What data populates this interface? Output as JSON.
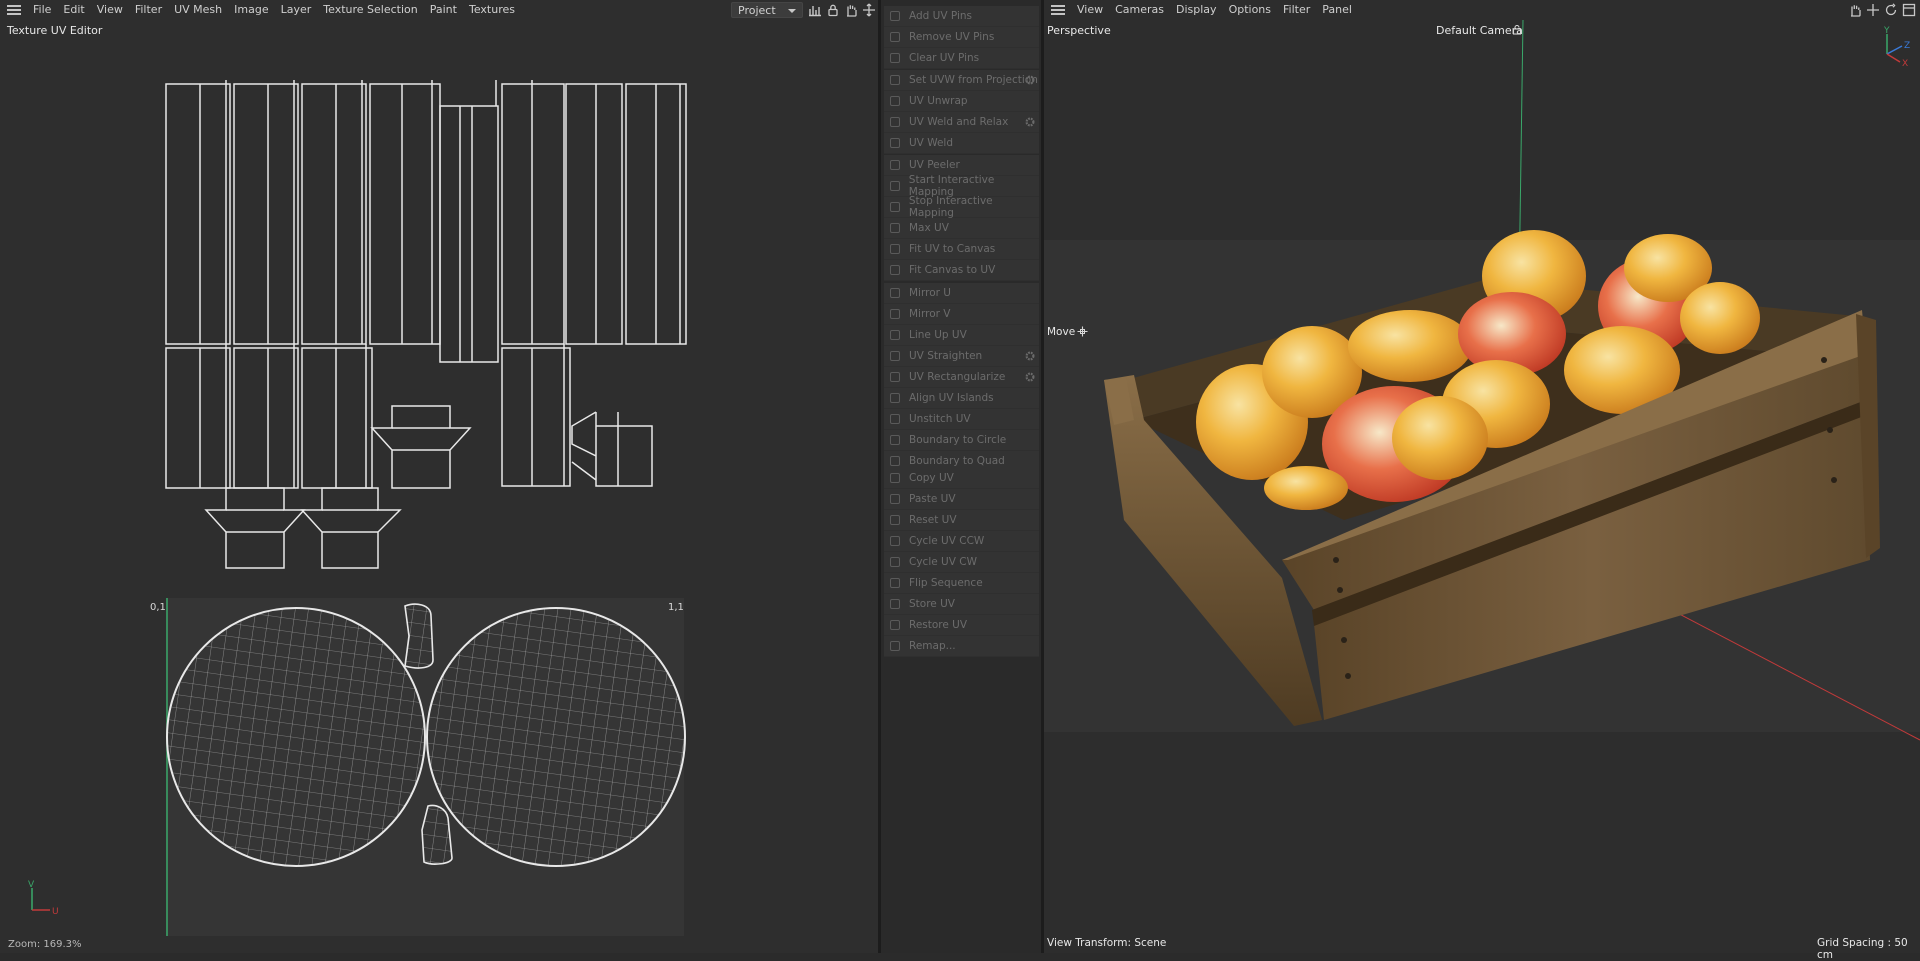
{
  "uv_editor": {
    "menu": [
      "File",
      "Edit",
      "View",
      "Filter",
      "UV Mesh",
      "Image",
      "Layer",
      "Texture Selection",
      "Paint",
      "Textures"
    ],
    "project_select": "Project",
    "title": "Texture UV Editor",
    "corner_tl": "0,1",
    "corner_tr": "1,1",
    "axis_v": "V",
    "axis_u": "U",
    "zoom": "Zoom: 169.3%"
  },
  "uv_commands": {
    "groups": [
      [
        "Add UV Pins",
        "Remove UV Pins",
        "Clear UV Pins"
      ],
      [
        "Set UVW from Projection",
        "UV Unwrap",
        "UV Weld and Relax",
        "UV Weld"
      ],
      [
        "UV Peeler",
        "Start Interactive Mapping",
        "Stop Interactive Mapping"
      ],
      [
        "Max UV",
        "Fit UV to Canvas",
        "Fit Canvas to UV"
      ],
      [
        "Mirror U",
        "Mirror V",
        "Line Up UV",
        "UV Straighten",
        "UV Rectangularize",
        "Align UV Islands",
        "Unstitch UV",
        "Boundary to Circle",
        "Boundary to Quad"
      ],
      [
        "Copy UV",
        "Paste UV",
        "Reset UV",
        "Cycle UV CCW",
        "Cycle UV CW",
        "Flip Sequence",
        "Store UV",
        "Restore UV",
        "Remap..."
      ]
    ],
    "with_settings": [
      "Set UVW from Projection",
      "UV Weld and Relax",
      "UV Straighten",
      "UV Rectangularize"
    ]
  },
  "viewport": {
    "menu": [
      "View",
      "Cameras",
      "Display",
      "Options",
      "Filter",
      "Panel"
    ],
    "view_name": "Perspective",
    "camera": "Default Camera",
    "move_label": "Move",
    "view_transform": "View Transform: Scene",
    "grid_spacing": "Grid Spacing : 50 cm",
    "axis_y": "Y",
    "axis_z": "Z",
    "axis_x": "X"
  },
  "colors": {
    "background": "#2e2e2e",
    "uv_wire": "#e8e8e8",
    "uv_grid": "#bdbdbd",
    "green_axis": "#3aa86a",
    "red_axis": "#c23a3a",
    "crate_wood": "#6b5232",
    "fruit_yellow": "#e8b33a",
    "fruit_red": "#d24a3a"
  }
}
